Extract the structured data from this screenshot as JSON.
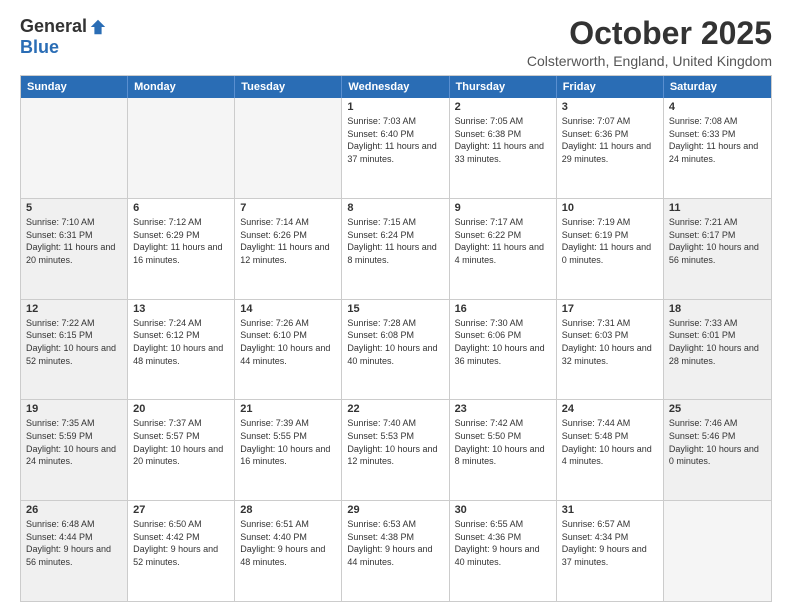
{
  "logo": {
    "general": "General",
    "blue": "Blue"
  },
  "title": "October 2025",
  "location": "Colsterworth, England, United Kingdom",
  "header_days": [
    "Sunday",
    "Monday",
    "Tuesday",
    "Wednesday",
    "Thursday",
    "Friday",
    "Saturday"
  ],
  "rows": [
    [
      {
        "day": "",
        "text": "",
        "empty": true
      },
      {
        "day": "",
        "text": "",
        "empty": true
      },
      {
        "day": "",
        "text": "",
        "empty": true
      },
      {
        "day": "1",
        "text": "Sunrise: 7:03 AM\nSunset: 6:40 PM\nDaylight: 11 hours and 37 minutes.",
        "empty": false
      },
      {
        "day": "2",
        "text": "Sunrise: 7:05 AM\nSunset: 6:38 PM\nDaylight: 11 hours and 33 minutes.",
        "empty": false
      },
      {
        "day": "3",
        "text": "Sunrise: 7:07 AM\nSunset: 6:36 PM\nDaylight: 11 hours and 29 minutes.",
        "empty": false
      },
      {
        "day": "4",
        "text": "Sunrise: 7:08 AM\nSunset: 6:33 PM\nDaylight: 11 hours and 24 minutes.",
        "empty": false
      }
    ],
    [
      {
        "day": "5",
        "text": "Sunrise: 7:10 AM\nSunset: 6:31 PM\nDaylight: 11 hours and 20 minutes.",
        "empty": false,
        "shaded": true
      },
      {
        "day": "6",
        "text": "Sunrise: 7:12 AM\nSunset: 6:29 PM\nDaylight: 11 hours and 16 minutes.",
        "empty": false
      },
      {
        "day": "7",
        "text": "Sunrise: 7:14 AM\nSunset: 6:26 PM\nDaylight: 11 hours and 12 minutes.",
        "empty": false
      },
      {
        "day": "8",
        "text": "Sunrise: 7:15 AM\nSunset: 6:24 PM\nDaylight: 11 hours and 8 minutes.",
        "empty": false
      },
      {
        "day": "9",
        "text": "Sunrise: 7:17 AM\nSunset: 6:22 PM\nDaylight: 11 hours and 4 minutes.",
        "empty": false
      },
      {
        "day": "10",
        "text": "Sunrise: 7:19 AM\nSunset: 6:19 PM\nDaylight: 11 hours and 0 minutes.",
        "empty": false
      },
      {
        "day": "11",
        "text": "Sunrise: 7:21 AM\nSunset: 6:17 PM\nDaylight: 10 hours and 56 minutes.",
        "empty": false,
        "shaded": true
      }
    ],
    [
      {
        "day": "12",
        "text": "Sunrise: 7:22 AM\nSunset: 6:15 PM\nDaylight: 10 hours and 52 minutes.",
        "empty": false,
        "shaded": true
      },
      {
        "day": "13",
        "text": "Sunrise: 7:24 AM\nSunset: 6:12 PM\nDaylight: 10 hours and 48 minutes.",
        "empty": false
      },
      {
        "day": "14",
        "text": "Sunrise: 7:26 AM\nSunset: 6:10 PM\nDaylight: 10 hours and 44 minutes.",
        "empty": false
      },
      {
        "day": "15",
        "text": "Sunrise: 7:28 AM\nSunset: 6:08 PM\nDaylight: 10 hours and 40 minutes.",
        "empty": false
      },
      {
        "day": "16",
        "text": "Sunrise: 7:30 AM\nSunset: 6:06 PM\nDaylight: 10 hours and 36 minutes.",
        "empty": false
      },
      {
        "day": "17",
        "text": "Sunrise: 7:31 AM\nSunset: 6:03 PM\nDaylight: 10 hours and 32 minutes.",
        "empty": false
      },
      {
        "day": "18",
        "text": "Sunrise: 7:33 AM\nSunset: 6:01 PM\nDaylight: 10 hours and 28 minutes.",
        "empty": false,
        "shaded": true
      }
    ],
    [
      {
        "day": "19",
        "text": "Sunrise: 7:35 AM\nSunset: 5:59 PM\nDaylight: 10 hours and 24 minutes.",
        "empty": false,
        "shaded": true
      },
      {
        "day": "20",
        "text": "Sunrise: 7:37 AM\nSunset: 5:57 PM\nDaylight: 10 hours and 20 minutes.",
        "empty": false
      },
      {
        "day": "21",
        "text": "Sunrise: 7:39 AM\nSunset: 5:55 PM\nDaylight: 10 hours and 16 minutes.",
        "empty": false
      },
      {
        "day": "22",
        "text": "Sunrise: 7:40 AM\nSunset: 5:53 PM\nDaylight: 10 hours and 12 minutes.",
        "empty": false
      },
      {
        "day": "23",
        "text": "Sunrise: 7:42 AM\nSunset: 5:50 PM\nDaylight: 10 hours and 8 minutes.",
        "empty": false
      },
      {
        "day": "24",
        "text": "Sunrise: 7:44 AM\nSunset: 5:48 PM\nDaylight: 10 hours and 4 minutes.",
        "empty": false
      },
      {
        "day": "25",
        "text": "Sunrise: 7:46 AM\nSunset: 5:46 PM\nDaylight: 10 hours and 0 minutes.",
        "empty": false,
        "shaded": true
      }
    ],
    [
      {
        "day": "26",
        "text": "Sunrise: 6:48 AM\nSunset: 4:44 PM\nDaylight: 9 hours and 56 minutes.",
        "empty": false,
        "shaded": true
      },
      {
        "day": "27",
        "text": "Sunrise: 6:50 AM\nSunset: 4:42 PM\nDaylight: 9 hours and 52 minutes.",
        "empty": false
      },
      {
        "day": "28",
        "text": "Sunrise: 6:51 AM\nSunset: 4:40 PM\nDaylight: 9 hours and 48 minutes.",
        "empty": false
      },
      {
        "day": "29",
        "text": "Sunrise: 6:53 AM\nSunset: 4:38 PM\nDaylight: 9 hours and 44 minutes.",
        "empty": false
      },
      {
        "day": "30",
        "text": "Sunrise: 6:55 AM\nSunset: 4:36 PM\nDaylight: 9 hours and 40 minutes.",
        "empty": false
      },
      {
        "day": "31",
        "text": "Sunrise: 6:57 AM\nSunset: 4:34 PM\nDaylight: 9 hours and 37 minutes.",
        "empty": false
      },
      {
        "day": "",
        "text": "",
        "empty": true,
        "shaded": true
      }
    ]
  ]
}
